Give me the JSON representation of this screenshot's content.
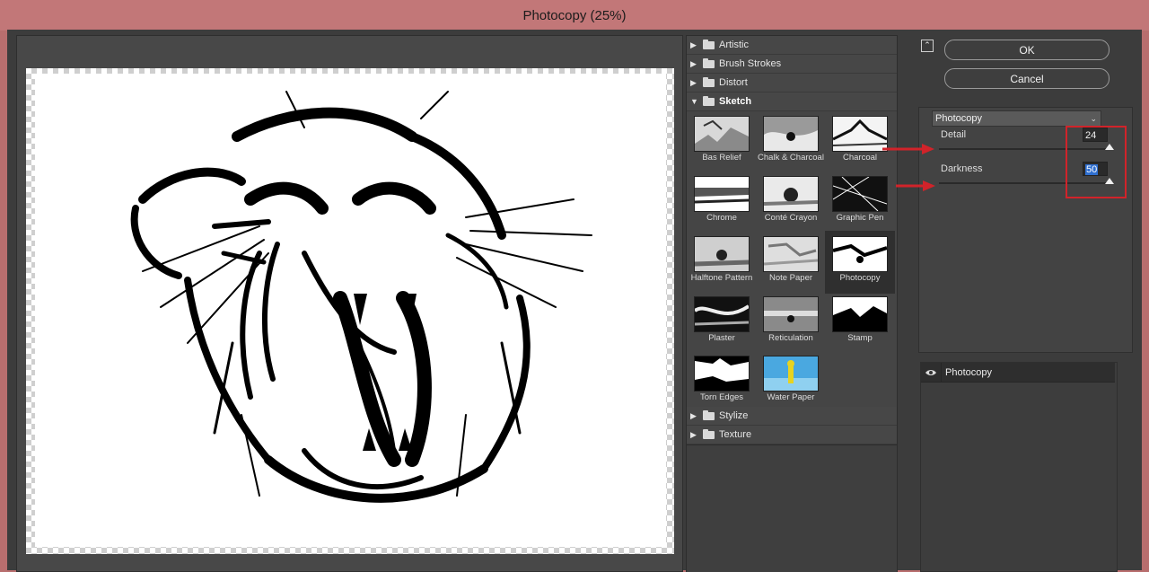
{
  "window": {
    "title": "Photocopy (25%)"
  },
  "gallery": {
    "categories_top": [
      {
        "label": "Artistic"
      },
      {
        "label": "Brush Strokes"
      },
      {
        "label": "Distort"
      },
      {
        "label": "Sketch"
      }
    ],
    "thumbs": [
      {
        "label": "Bas Relief"
      },
      {
        "label": "Chalk & Charcoal"
      },
      {
        "label": "Charcoal"
      },
      {
        "label": "Chrome"
      },
      {
        "label": "Conté Crayon"
      },
      {
        "label": "Graphic Pen"
      },
      {
        "label": "Halftone Pattern"
      },
      {
        "label": "Note Paper"
      },
      {
        "label": "Photocopy"
      },
      {
        "label": "Plaster"
      },
      {
        "label": "Reticulation"
      },
      {
        "label": "Stamp"
      },
      {
        "label": "Torn Edges"
      },
      {
        "label": "Water Paper"
      }
    ],
    "categories_bottom": [
      {
        "label": "Stylize"
      },
      {
        "label": "Texture"
      }
    ],
    "selected_filter": "Photocopy"
  },
  "buttons": {
    "ok": "OK",
    "cancel": "Cancel"
  },
  "settings": {
    "filter_select": "Photocopy",
    "detail": {
      "label": "Detail",
      "value": "24",
      "max": 24
    },
    "darkness": {
      "label": "Darkness",
      "value": "50",
      "max": 50
    }
  },
  "layers": [
    {
      "name": "Photocopy"
    }
  ],
  "colors": {
    "titlebar": "#c27778",
    "panel": "#3c3c3c",
    "highlight_box": "#d1232a"
  }
}
